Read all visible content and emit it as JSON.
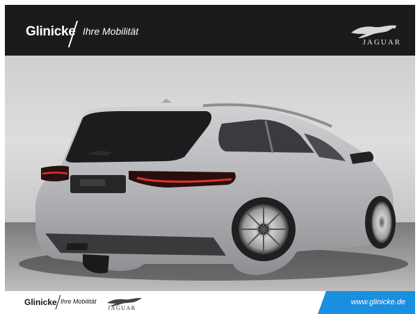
{
  "header": {
    "brand": "Glinicke",
    "tagline": "Ihre Mobilität",
    "logo_text": "JAGUAR",
    "logo_icon": "jaguar-leaper-icon"
  },
  "photo": {
    "subject": "car-photo",
    "car_color": "#b9babd",
    "background_color": "#d8d8d8"
  },
  "footer": {
    "brand": "Glinicke",
    "tagline": "Ihre Mobilität",
    "logo_text": "JAGUAR",
    "logo_icon": "jaguar-leaper-icon",
    "url": "www.glinicke.de",
    "accent_color": "#1a8fe0"
  }
}
